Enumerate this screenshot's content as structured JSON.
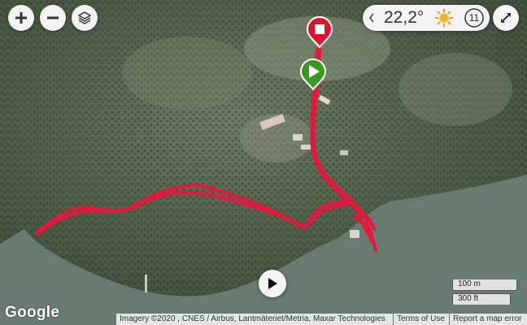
{
  "weather": {
    "temperature": "22,2°",
    "condition_icon": "sun-icon",
    "hour": "11"
  },
  "controls": {
    "zoom_in_icon": "plus-icon",
    "zoom_out_icon": "minus-icon",
    "layers_icon": "layers-icon",
    "fullscreen_icon": "expand-icon",
    "play_icon": "play-icon"
  },
  "markers": {
    "start_icon": "play-icon",
    "end_icon": "stop-icon",
    "start_color": "#3a9a1f",
    "end_color": "#e0102a"
  },
  "track": {
    "color": "#e8163c"
  },
  "footer": {
    "logo": "Google",
    "scale_metric": "100 m",
    "scale_imperial": "300 ft",
    "imagery": "Imagery ©2020 , CNES / Airbus, Lantmäteriet/Metria, Maxar Technologies",
    "terms": "Terms of Use",
    "report": "Report a map error"
  }
}
